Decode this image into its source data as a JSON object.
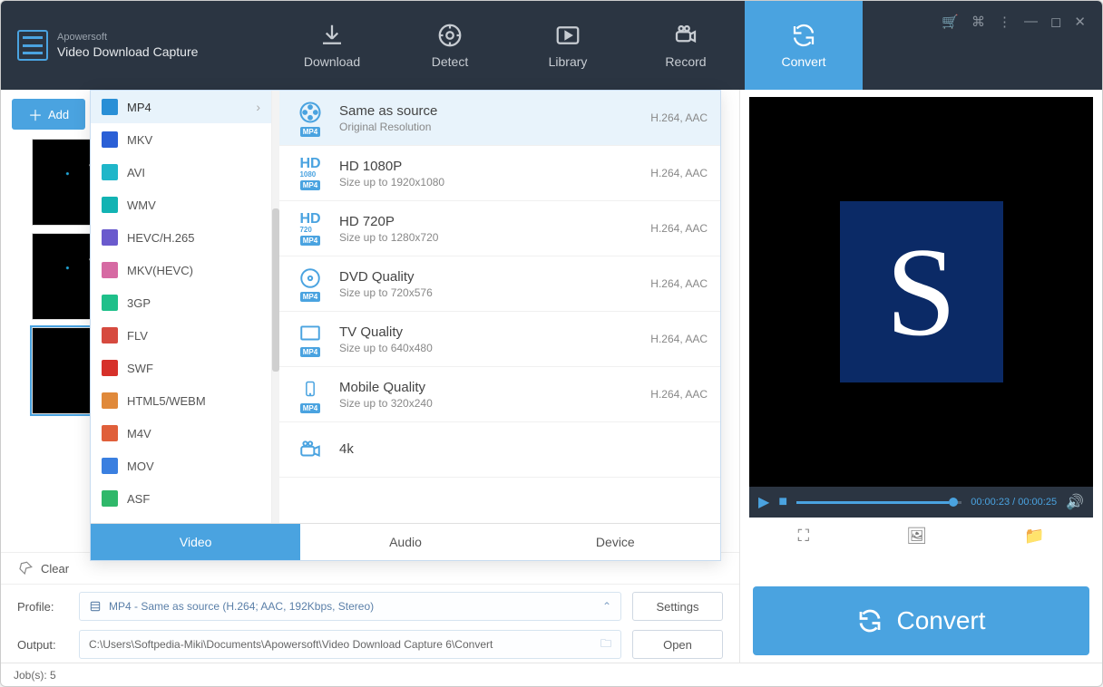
{
  "brand": "Apowersoft",
  "app_name": "Video Download Capture",
  "nav": {
    "download": "Download",
    "detect": "Detect",
    "library": "Library",
    "record": "Record",
    "convert": "Convert"
  },
  "add_button": "Add",
  "clear_label": "Clear",
  "formats": [
    {
      "label": "MP4",
      "color": "#2a8fd6"
    },
    {
      "label": "MKV",
      "color": "#2a5fd6"
    },
    {
      "label": "AVI",
      "color": "#1fb6c9"
    },
    {
      "label": "WMV",
      "color": "#12b3b3"
    },
    {
      "label": "HEVC/H.265",
      "color": "#6a5acd"
    },
    {
      "label": "MKV(HEVC)",
      "color": "#d66aa3"
    },
    {
      "label": "3GP",
      "color": "#1fc08a"
    },
    {
      "label": "FLV",
      "color": "#d64a3f"
    },
    {
      "label": "SWF",
      "color": "#d6312a"
    },
    {
      "label": "HTML5/WEBM",
      "color": "#e0893a"
    },
    {
      "label": "M4V",
      "color": "#e05f3a"
    },
    {
      "label": "MOV",
      "color": "#3a7fe0"
    },
    {
      "label": "ASF",
      "color": "#2fb86a"
    }
  ],
  "presets": [
    {
      "title": "Same as source",
      "sub": "Original Resolution",
      "codec": "H.264, AAC",
      "badge": "MP4",
      "icon": "reel"
    },
    {
      "title": "HD 1080P",
      "sub": "Size up to 1920x1080",
      "codec": "H.264, AAC",
      "badge": "MP4",
      "icon": "hd1080"
    },
    {
      "title": "HD 720P",
      "sub": "Size up to 1280x720",
      "codec": "H.264, AAC",
      "badge": "MP4",
      "icon": "hd720"
    },
    {
      "title": "DVD Quality",
      "sub": "Size up to 720x576",
      "codec": "H.264, AAC",
      "badge": "MP4",
      "icon": "disc"
    },
    {
      "title": "TV Quality",
      "sub": "Size up to 640x480",
      "codec": "H.264, AAC",
      "badge": "MP4",
      "icon": "tv"
    },
    {
      "title": "Mobile Quality",
      "sub": "Size up to 320x240",
      "codec": "H.264, AAC",
      "badge": "MP4",
      "icon": "mobile"
    },
    {
      "title": "4k",
      "sub": "",
      "codec": "",
      "badge": "",
      "icon": "cam"
    }
  ],
  "profile_tabs": {
    "video": "Video",
    "audio": "Audio",
    "device": "Device"
  },
  "profile_label": "Profile:",
  "profile_value": "MP4 - Same as source (H.264; AAC, 192Kbps, Stereo)",
  "output_label": "Output:",
  "output_value": "C:\\Users\\Softpedia-Miki\\Documents\\Apowersoft\\Video Download Capture 6\\Convert",
  "settings_btn": "Settings",
  "open_btn": "Open",
  "convert_btn": "Convert",
  "player": {
    "elapsed": "00:00:23",
    "total": "00:00:25"
  },
  "status": "Job(s): 5"
}
